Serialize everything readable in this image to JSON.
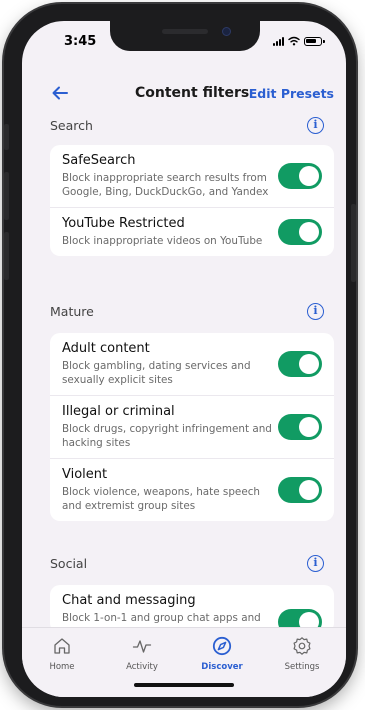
{
  "status": {
    "time": "3:45"
  },
  "header": {
    "title": "Content filters",
    "edit_presets": "Edit Presets"
  },
  "sections": [
    {
      "title": "Search",
      "items": [
        {
          "title": "SafeSearch",
          "desc": "Block inappropriate search results from Google, Bing, DuckDuckGo, and Yandex",
          "enabled": true
        },
        {
          "title": "YouTube Restricted",
          "desc": "Block inappropriate videos on YouTube",
          "enabled": true
        }
      ]
    },
    {
      "title": "Mature",
      "items": [
        {
          "title": "Adult content",
          "desc": "Block gambling, dating services and sexually explicit sites",
          "enabled": true
        },
        {
          "title": "Illegal or criminal",
          "desc": "Block drugs, copyright infringement and hacking sites",
          "enabled": true
        },
        {
          "title": "Violent",
          "desc": "Block violence, weapons, hate speech and extremist group sites",
          "enabled": true
        }
      ]
    },
    {
      "title": "Social",
      "items": [
        {
          "title": "Chat and messaging",
          "desc": "Block 1-on-1 and group chat apps and",
          "enabled": true
        }
      ]
    }
  ],
  "tabs": [
    {
      "label": "Home",
      "icon": "home-icon",
      "active": false
    },
    {
      "label": "Activity",
      "icon": "activity-icon",
      "active": false
    },
    {
      "label": "Discover",
      "icon": "compass-icon",
      "active": true
    },
    {
      "label": "Settings",
      "icon": "gear-icon",
      "active": false
    }
  ],
  "colors": {
    "accent": "#2b5fd1",
    "toggle_on": "#119b63",
    "background": "#f4f1f6"
  }
}
